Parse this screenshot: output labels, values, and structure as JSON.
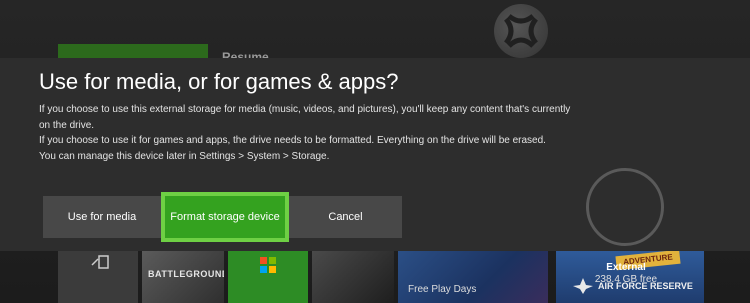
{
  "dialog": {
    "title": "Use for media, or for games & apps?",
    "paragraphs": [
      "If you choose to use this external storage for media (music, videos, and pictures), you'll keep any content that's currently on the drive.",
      "If you choose to use it for games and apps, the drive needs to be formatted. Everything on the drive will be erased.",
      "You can manage this device later in Settings > System > Storage."
    ],
    "buttons": {
      "media": "Use for media",
      "format": "Format storage device",
      "cancel": "Cancel"
    },
    "focused_button": "format"
  },
  "drive": {
    "name": "External",
    "free": "238.4 GB free"
  },
  "background": {
    "resume_label": "Resume",
    "tiles": [
      {
        "label": "BATTLEGROUNDS"
      },
      {
        "label": "Free Play Days"
      },
      {
        "label": "ADVENTURE"
      },
      {
        "label": "AIR FORCE RESERVE"
      }
    ]
  },
  "colors": {
    "accent_green": "#34a21f",
    "focus_border": "#6ed044",
    "dialog_bg": "#2d2d2d",
    "button_bg": "#484848"
  }
}
